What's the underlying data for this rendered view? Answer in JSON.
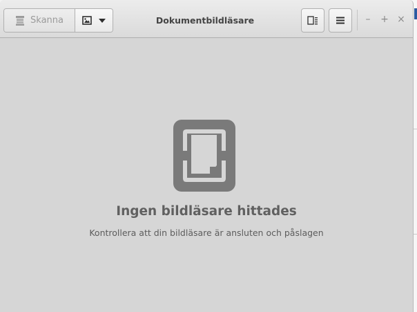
{
  "window": {
    "title": "Dokumentbildläsare"
  },
  "toolbar": {
    "scan_label": "Skanna",
    "scan_icon": "scanner-icon",
    "source_icon": "image-icon",
    "dropdown_icon": "chevron-down-icon",
    "preferences_icon": "document-properties-icon",
    "menu_icon": "hamburger-menu-icon"
  },
  "window_controls": {
    "minimize": "–",
    "maximize": "+",
    "close": "×"
  },
  "empty_state": {
    "icon": "no-scanner-icon",
    "heading": "Ingen bildläsare hittades",
    "message": "Kontrollera att din bildläsare är ansluten och påslagen"
  },
  "colors": {
    "icon": "#7a7a7a",
    "background": "#d6d6d6",
    "header": "#e6e6e6"
  }
}
